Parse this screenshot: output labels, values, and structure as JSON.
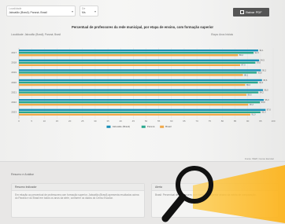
{
  "filters": {
    "locality": {
      "label": "Localidade",
      "value": "Jaboatão (Brasil); Paraná; Brasil"
    },
    "year": {
      "label": "De",
      "value": "Ms"
    }
  },
  "actions": {
    "download_label": "Baixar PDF"
  },
  "chart_heading": "Percentual de professores da rede municipal, por etapa de ensino, com formação superior",
  "locality_note": "Localidade: Jaboatão (Brasil); Paraná; Brasil",
  "stage_note": "Etapa: Anos Iniciais",
  "source": "Fonte: INEP, Censo Escolar",
  "colors": {
    "series_a": "#1a8fb8",
    "series_b": "#29a88e",
    "series_c": "#f0a94a"
  },
  "chart_data": {
    "type": "bar",
    "orientation": "horizontal",
    "categories": [
      "2017",
      "2018",
      "2019",
      "2020",
      "2021",
      "2022",
      "2023"
    ],
    "series": [
      {
        "name": "Jaboatão (Brasil)",
        "values": [
          94.1,
          94.5,
          95.2,
          95.6,
          96.0,
          96.3,
          97.0
        ]
      },
      {
        "name": "Paraná",
        "values": [
          92.3,
          93.0,
          93.5,
          94.0,
          94.2,
          94.8,
          95.0
        ]
      },
      {
        "name": "Brasil",
        "values": [
          86.2,
          87.0,
          88.1,
          89.0,
          89.5,
          90.2,
          91.0
        ]
      }
    ],
    "xlim": [
      0,
      100
    ],
    "xticks": [
      "0",
      "5",
      "10",
      "15",
      "20",
      "25",
      "30",
      "35",
      "40",
      "45",
      "50",
      "55",
      "60",
      "65",
      "70",
      "75",
      "80",
      "85",
      "90",
      "95",
      "100"
    ],
    "legend_position": "bottom-center",
    "grid": true
  },
  "insights": {
    "section_title": "Resumo e Análise",
    "card1": {
      "title": "Resumo Indicador",
      "text": "Em relação ao percentual de professores com formação superior, Jaboatão (Brasil) apresenta resultados acima do Paraná e do Brasil em todos os anos da série, conforme os dados do Censo Escolar."
    },
    "card2": {
      "title": "Alerta",
      "text": "Brasil: Percentual de professores com formação superior abaixo da média de comparação."
    }
  }
}
